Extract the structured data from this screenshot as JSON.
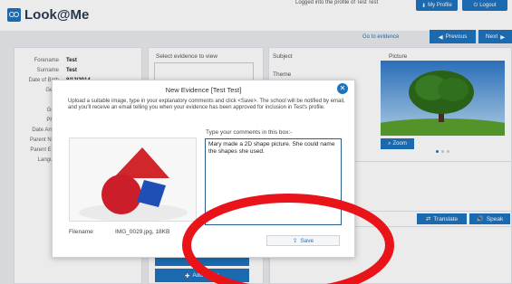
{
  "header": {
    "app_name": "Look@Me",
    "profile_message": "Logged into the profile of Test Test",
    "my_profile_label": "My Profile",
    "logout_label": "Logout"
  },
  "nav": {
    "goto_evidence": "Go to evidence",
    "previous_label": "Prevous",
    "next_label": "Next"
  },
  "profile": {
    "fields": [
      {
        "label": "Forename",
        "value": "Test"
      },
      {
        "label": "Surname",
        "value": "Test"
      },
      {
        "label": "Date of Birth",
        "value": "8/12/2014"
      },
      {
        "label": "Gend",
        "value": ""
      },
      {
        "label": "UP",
        "value": ""
      },
      {
        "label": "Grou",
        "value": ""
      },
      {
        "label": "Phas",
        "value": ""
      },
      {
        "label": "Date Arrive",
        "value": ""
      },
      {
        "label": "Parent Nam",
        "value": ""
      },
      {
        "label": "Parent Ema",
        "value": ""
      },
      {
        "label": "Languag",
        "value": ""
      }
    ]
  },
  "evidence_panel": {
    "select_label": "Select evidence to view",
    "add_label": "Add Evide"
  },
  "subject_panel": {
    "subject_label": "Subject",
    "theme_label": "Theme",
    "picture_label": "Picture",
    "zoom_label": "Zoom",
    "translate_label": "Translate",
    "speak_label": "Speak"
  },
  "modal": {
    "title": "New Evidence [Test Test]",
    "instructions": "Upload a suitable image, type in your explanatory comments and click <Save>. The school will be notified by email, and you'll receive an email telling you when your evidence has been approved for inclusion in Test's profile.",
    "filename_label": "Filename",
    "filename_value": "IMG_0029.jpg, 18KB",
    "comment_prompt": "Type your comments in this box:-",
    "comment_text": "Mary made a 2D shape picture. She could name the shapes she used.",
    "save_label": "Save"
  },
  "colors": {
    "accent": "#1e73be",
    "annotation": "#e8141a"
  }
}
